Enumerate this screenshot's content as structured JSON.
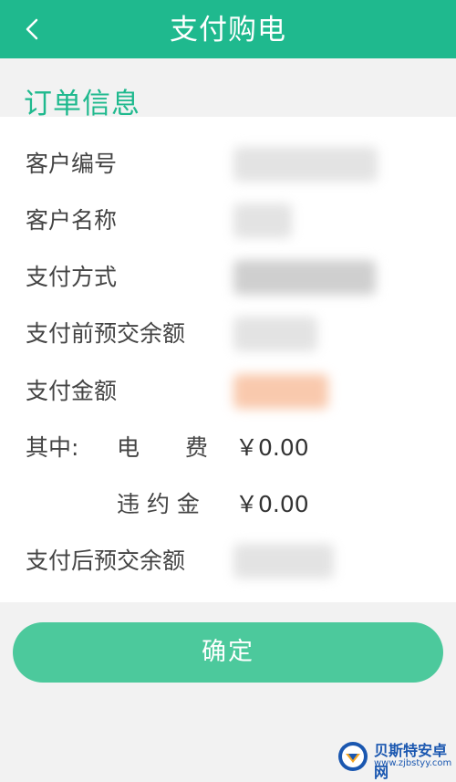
{
  "header": {
    "back_icon": "chevron-left-icon",
    "title": "支付购电",
    "background_color": "#1fb98e"
  },
  "section": {
    "title": "订单信息"
  },
  "order": {
    "customer_number_label": "客户编号",
    "customer_name_label": "客户名称",
    "payment_method_label": "支付方式",
    "balance_before_label": "支付前预交余额",
    "payment_amount_label": "支付金额",
    "breakdown_label": "其中:",
    "electricity_fee_label": "电　　费",
    "electricity_fee_value": "￥0.00",
    "penalty_label": "违 约 金",
    "penalty_value": "￥0.00",
    "balance_after_label": "支付后预交余额"
  },
  "confirm": {
    "label": "确定",
    "color": "#4cc99c"
  },
  "watermark": {
    "name": "贝斯特安卓网",
    "url": "www.zjbstyy.com"
  }
}
